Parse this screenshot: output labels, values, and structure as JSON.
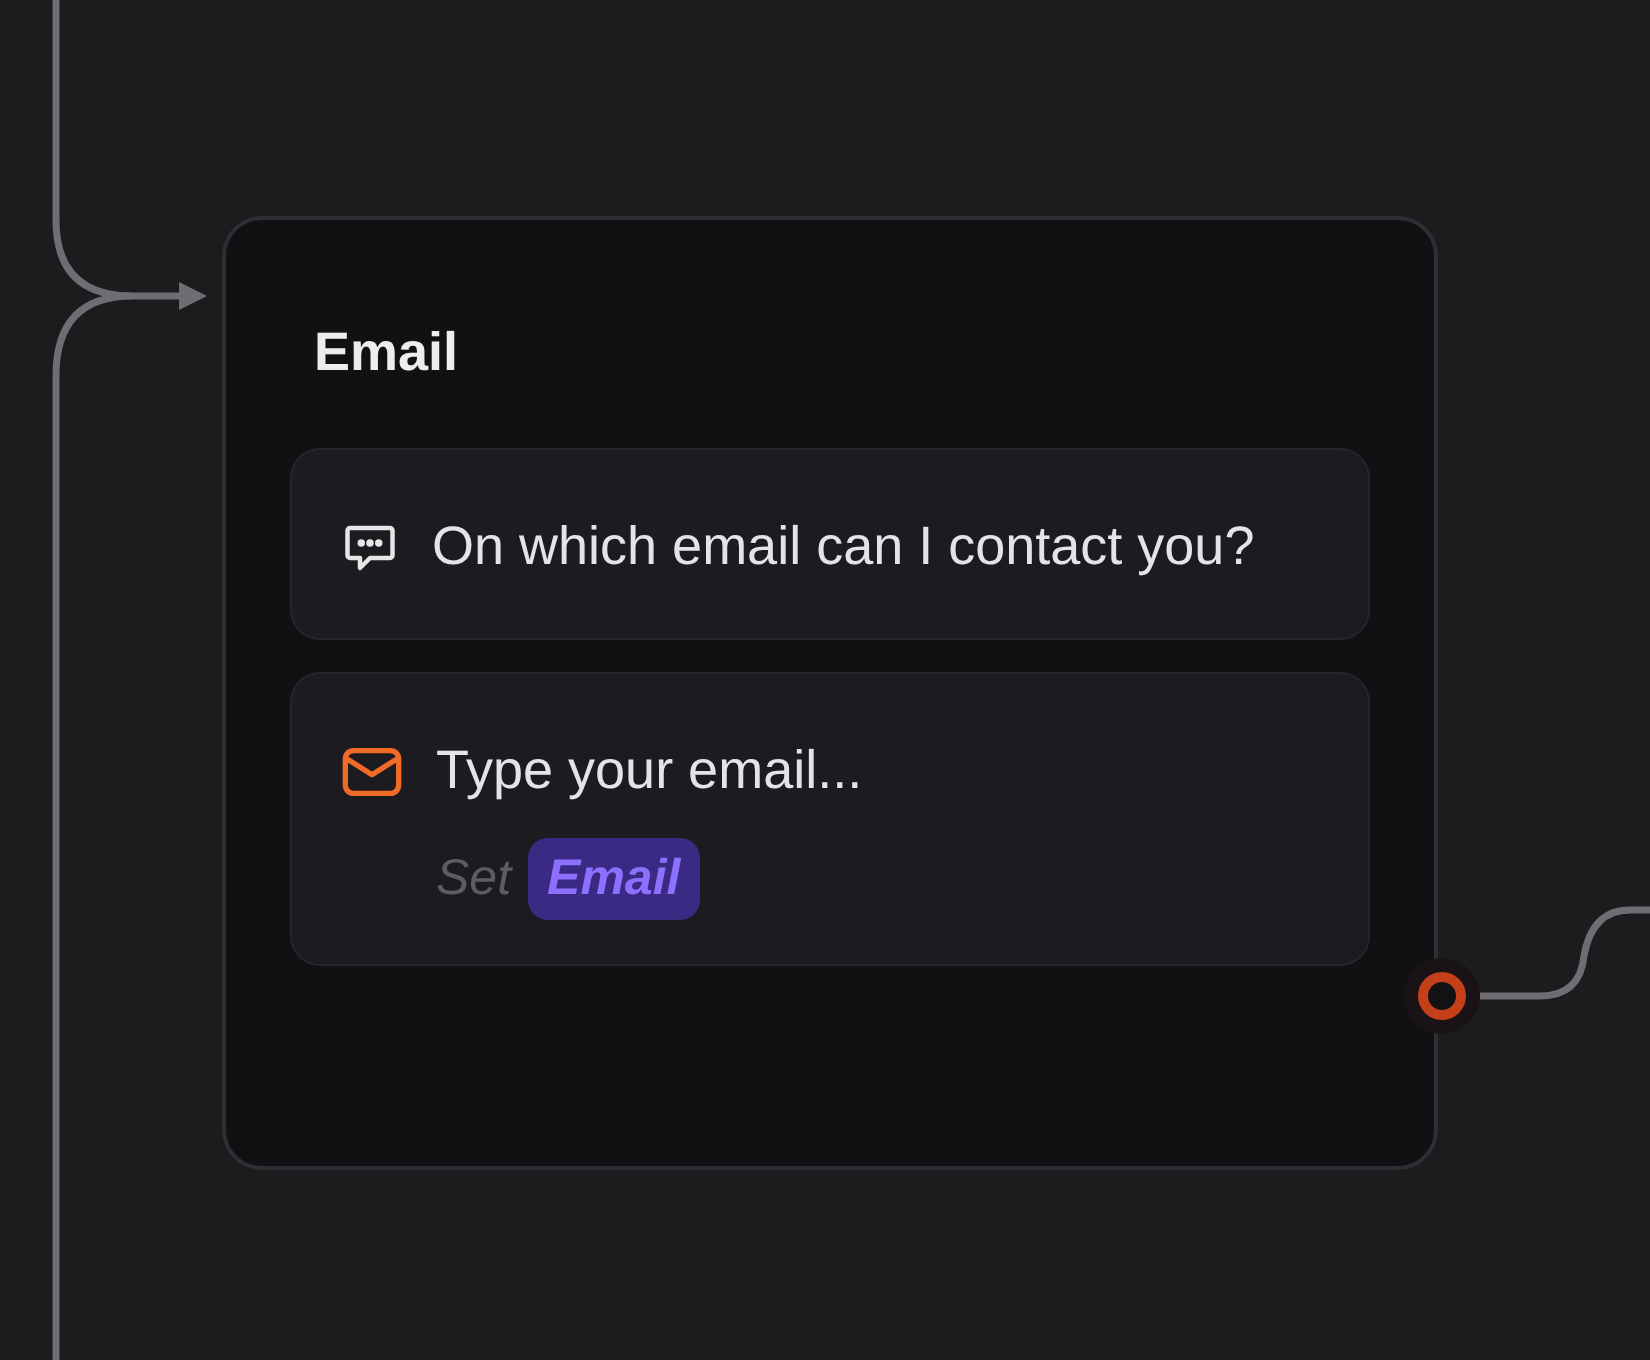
{
  "node": {
    "title": "Email",
    "blocks": [
      {
        "kind": "text",
        "text": "On which email can I contact you?"
      },
      {
        "kind": "email_input",
        "text": "Type your email...",
        "set_label": "Set",
        "variable": "Email"
      }
    ]
  }
}
